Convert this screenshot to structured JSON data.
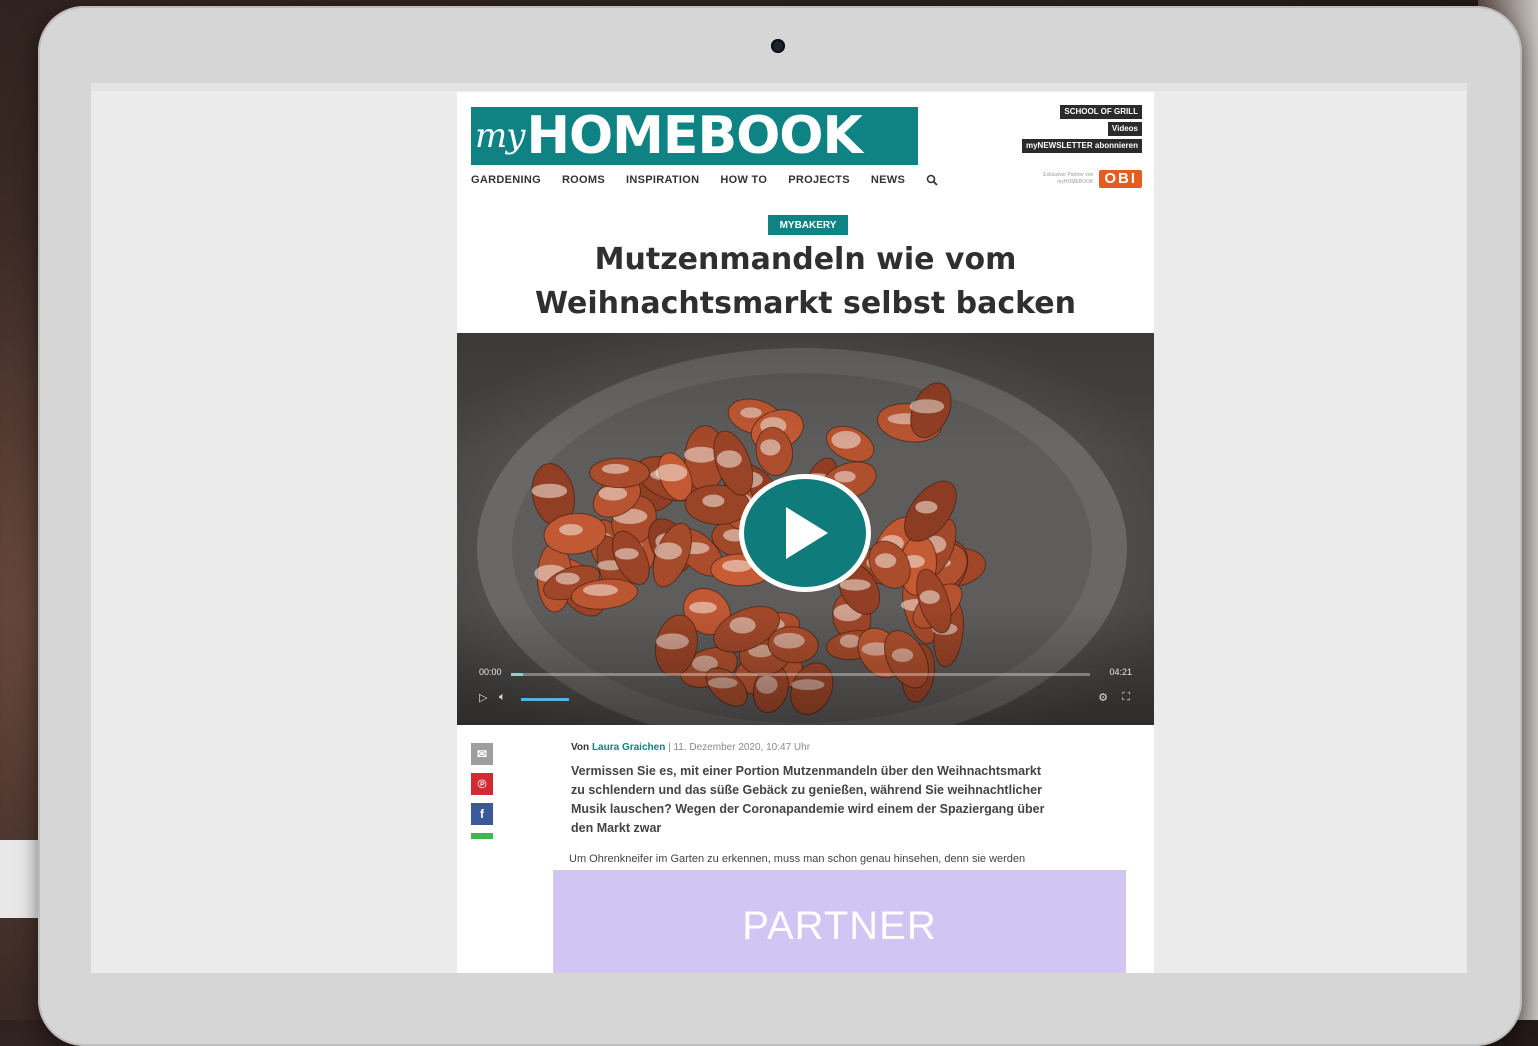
{
  "site": {
    "logo_prefix": "my",
    "logo_main": "HOMEBOOK",
    "top_links": [
      "SCHOOL OF GRILL",
      "Videos",
      "myNEWSLETTER abonnieren"
    ],
    "nav": [
      "GARDENING",
      "ROOMS",
      "INSPIRATION",
      "HOW TO",
      "PROJECTS",
      "NEWS"
    ],
    "partner_text": "Exklusiver Partner von myHOMEBOOK",
    "partner_logo": "OBI"
  },
  "article": {
    "category": "MYBAKERY",
    "title": "Mutzenmandeln wie vom Weihnachtsmarkt selbst backen",
    "byline_prefix": "Von",
    "author": "Laura Graichen",
    "date": "11. Dezember 2020, 10:47 Uhr",
    "lead": "Vermissen Sie es, mit einer Portion Mutzenmandeln über den Weihnachtsmarkt zu schlendern und das süße Gebäck zu genießen, während Sie weihnachtlicher Musik lauschen? Wegen der Coronapandemie wird einem der Spaziergang über den Markt zwar",
    "excerpt": "Um Ohrenkneifer im Garten zu erkennen, muss man schon genau hinsehen, denn sie werden"
  },
  "video": {
    "time_current": "00:00",
    "time_total": "04:21",
    "progress": 0.02,
    "volume": 0.8
  },
  "share": [
    "mail-icon",
    "pinterest-icon",
    "facebook-icon",
    "whatsapp-icon"
  ],
  "ad": {
    "label": "PARTNER"
  },
  "colors": {
    "brand": "#0f8384",
    "ad_bg": "#d0c5f3",
    "obi": "#e65b1e"
  }
}
